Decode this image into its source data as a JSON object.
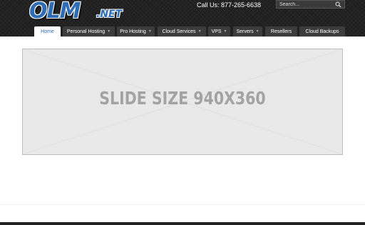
{
  "brand": {
    "logo_main": "OLM",
    "logo_suffix": ".NET"
  },
  "header": {
    "call_text": "Call Us: 877-265-6638"
  },
  "search": {
    "placeholder": "Search..."
  },
  "nav": {
    "items": [
      {
        "label": "Home",
        "active": true,
        "dropdown": false
      },
      {
        "label": "Personal Hosting",
        "dropdown": true
      },
      {
        "label": "Pro Hosting",
        "dropdown": true
      },
      {
        "label": "Cloud Services",
        "dropdown": true
      },
      {
        "label": "VPS",
        "dropdown": true
      },
      {
        "label": "Servers",
        "dropdown": true
      },
      {
        "label": "Resellers",
        "dropdown": false
      },
      {
        "label": "Cloud Backups",
        "dropdown": false
      }
    ]
  },
  "slider": {
    "text": "SLIDE SIZE 940X360"
  },
  "icons": {
    "search": "search-icon",
    "dropdown": "chevron-down-icon"
  }
}
